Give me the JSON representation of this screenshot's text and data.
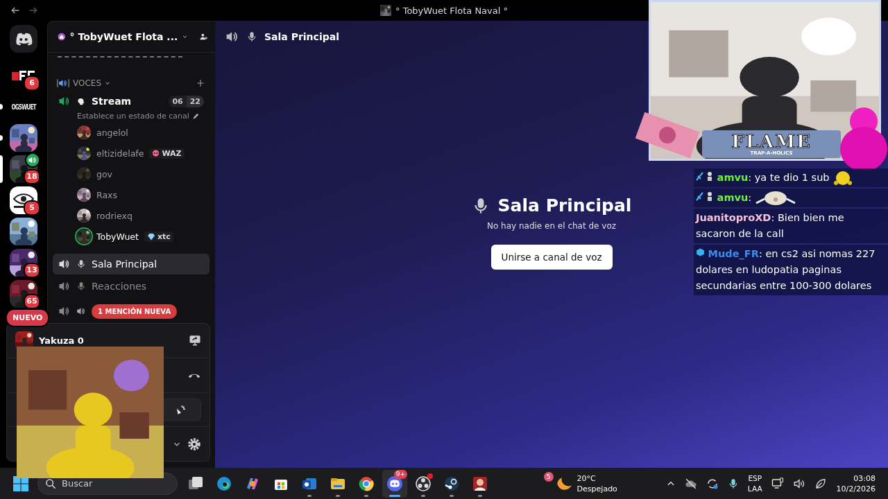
{
  "titlebar": {
    "title": "° TobyWuet Flota Naval °"
  },
  "rail": {
    "servers": [
      {
        "kind": "block-logo",
        "badge": "6",
        "selected": false,
        "unread": false,
        "in_voice": false
      },
      {
        "kind": "text-logo",
        "label": "OGSWUET",
        "selected": false,
        "unread": true,
        "in_voice": false
      },
      {
        "kind": "picture",
        "selected": false,
        "unread": true,
        "in_voice": false
      },
      {
        "kind": "picture",
        "badge": "18",
        "selected": true,
        "unread": false,
        "in_voice": true
      },
      {
        "kind": "eye-logo",
        "badge": "5",
        "selected": false,
        "unread": false,
        "in_voice": false
      },
      {
        "kind": "picture",
        "selected": false,
        "unread": false,
        "in_voice": false
      },
      {
        "kind": "picture",
        "badge": "13",
        "selected": false,
        "unread": false,
        "in_voice": false
      },
      {
        "kind": "picture",
        "badge": "65",
        "selected": false,
        "unread": false,
        "in_voice": false
      }
    ],
    "new_pill": "NUEVO"
  },
  "sidebar": {
    "server_name": "° TobyWuet Flota ...",
    "category": {
      "label": "VOCES",
      "expanded": true
    },
    "channels": [
      {
        "name": "Stream",
        "active": true,
        "selected": false,
        "user_count": "06",
        "user_limit": "22",
        "status_hint": "Establece un estado de canal",
        "members": [
          {
            "name": "angelol",
            "speaking": false
          },
          {
            "name": "eltizidelafe",
            "tag": "WAZ",
            "speaking": false
          },
          {
            "name": "gov",
            "speaking": false
          },
          {
            "name": "Raxs",
            "speaking": false
          },
          {
            "name": "rodriexq",
            "speaking": false
          },
          {
            "name": "TobyWuet",
            "tag": "xtc",
            "speaking": true
          }
        ]
      },
      {
        "name": "Sala Principal",
        "active": false,
        "selected": true
      },
      {
        "name": "Reacciones",
        "active": false,
        "selected": false
      },
      {
        "mention_pill": "1 MENCIÓN NUEVA",
        "active": false,
        "selected": false
      }
    ],
    "user_panel": {
      "activity": "Yakuza 0"
    }
  },
  "main": {
    "header_title": "Sala Principal",
    "empty_title": "Sala Principal",
    "empty_text": "No hay nadie en el chat de voz",
    "join_button": "Unirse a canal de voz"
  },
  "overlay": {
    "banner_title": "FLAME",
    "banner_subtitle": "TRAP-A-HOLICS",
    "chat": [
      {
        "kind": "mod-smiley",
        "user": "amvu",
        "color": "#6cf23a",
        "text": ": ya te dio 1 sub"
      },
      {
        "kind": "mod-cat",
        "user": "amvu",
        "color": "#6cf23a",
        "text": ":"
      },
      {
        "kind": "plain",
        "user": "JuanitoproXD",
        "color": "#f6c2dc",
        "text": ": Bien bien me sacaron de la call"
      },
      {
        "kind": "cube",
        "user": "Mude_FR",
        "color": "#3b8de8",
        "text": ": en cs2 asi nomas 227 dolares en ludopatia paginas secundarias entre 100-300 dolares"
      }
    ]
  },
  "taskbar": {
    "search_placeholder": "Buscar",
    "apps": [
      {
        "kind": "taskview",
        "running": false,
        "selected": false
      },
      {
        "kind": "edge",
        "running": false,
        "selected": false
      },
      {
        "kind": "copilot",
        "running": false,
        "selected": false
      },
      {
        "kind": "store",
        "running": false,
        "selected": false
      },
      {
        "kind": "outlook",
        "running": true,
        "selected": false
      },
      {
        "kind": "files",
        "running": true,
        "selected": false
      },
      {
        "kind": "chrome",
        "running": true,
        "selected": false
      },
      {
        "kind": "discord",
        "badge": "9+",
        "running": true,
        "selected": true
      },
      {
        "kind": "obs",
        "running": true,
        "selected": false
      },
      {
        "kind": "steam",
        "running": true,
        "selected": false
      },
      {
        "kind": "game",
        "running": true,
        "selected": false
      }
    ],
    "weather": {
      "badge": "5",
      "temp": "20°C",
      "condition": "Despejado"
    },
    "language": [
      "ESP",
      "LAA"
    ],
    "time": "03:08",
    "date": "10/2/2026"
  }
}
